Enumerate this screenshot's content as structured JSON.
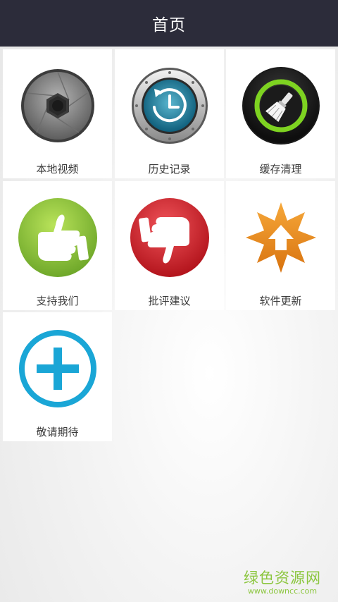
{
  "header": {
    "title": "首页"
  },
  "tiles": [
    {
      "label": "本地视频",
      "icon": "camera-shutter-icon"
    },
    {
      "label": "历史记录",
      "icon": "history-clock-icon"
    },
    {
      "label": "缓存清理",
      "icon": "cache-clean-brush-icon"
    },
    {
      "label": "支持我们",
      "icon": "thumbs-up-icon"
    },
    {
      "label": "批评建议",
      "icon": "thumbs-down-icon"
    },
    {
      "label": "软件更新",
      "icon": "update-star-arrow-icon"
    },
    {
      "label": "敬请期待",
      "icon": "plus-circle-icon"
    }
  ],
  "watermark": {
    "main": "绿色资源网",
    "sub": "www.downcc.com"
  },
  "colors": {
    "header_bg": "#2c2c3a",
    "tile_bg": "#ffffff",
    "plus_blue": "#1aa6d6",
    "thumb_up_green": "#8cc63f",
    "thumb_down_red": "#d9232d",
    "update_orange": "#f08c1a",
    "clean_green": "#7ed321",
    "watermark_green": "#8cc63f"
  }
}
